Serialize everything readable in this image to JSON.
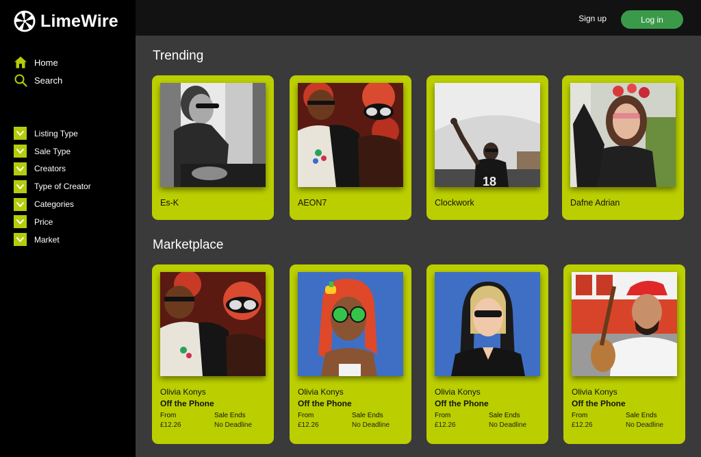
{
  "brand": {
    "name": "LimeWire",
    "icon": "lime-slice-icon",
    "accent": "#bbcf00"
  },
  "header": {
    "signup_label": "Sign up",
    "login_label": "Log in",
    "login_color": "#3a9a4a"
  },
  "nav": [
    {
      "label": "Home",
      "icon": "home-icon"
    },
    {
      "label": "Search",
      "icon": "search-icon"
    }
  ],
  "filters": [
    {
      "label": "Listing Type"
    },
    {
      "label": "Sale Type"
    },
    {
      "label": "Creators"
    },
    {
      "label": "Type of Creator"
    },
    {
      "label": "Categories"
    },
    {
      "label": "Price"
    },
    {
      "label": "Market"
    }
  ],
  "trending": {
    "title": "Trending",
    "items": [
      {
        "name": "Es-K"
      },
      {
        "name": "AEON7"
      },
      {
        "name": "Clockwork"
      },
      {
        "name": "Dafne Adrian"
      }
    ]
  },
  "marketplace": {
    "title": "Marketplace",
    "items": [
      {
        "creator": "Olivia Konys",
        "title": "Off the Phone",
        "from_label": "From",
        "price": "£12.26",
        "ends_label": "Sale Ends",
        "ends_value": "No Deadline"
      },
      {
        "creator": "Olivia Konys",
        "title": "Off the Phone",
        "from_label": "From",
        "price": "£12.26",
        "ends_label": "Sale Ends",
        "ends_value": "No Deadline"
      },
      {
        "creator": "Olivia Konys",
        "title": "Off the Phone",
        "from_label": "From",
        "price": "£12.26",
        "ends_label": "Sale Ends",
        "ends_value": "No Deadline"
      },
      {
        "creator": "Olivia Konys",
        "title": "Off the Phone",
        "from_label": "From",
        "price": "£12.26",
        "ends_label": "Sale Ends",
        "ends_value": "No Deadline"
      }
    ]
  }
}
